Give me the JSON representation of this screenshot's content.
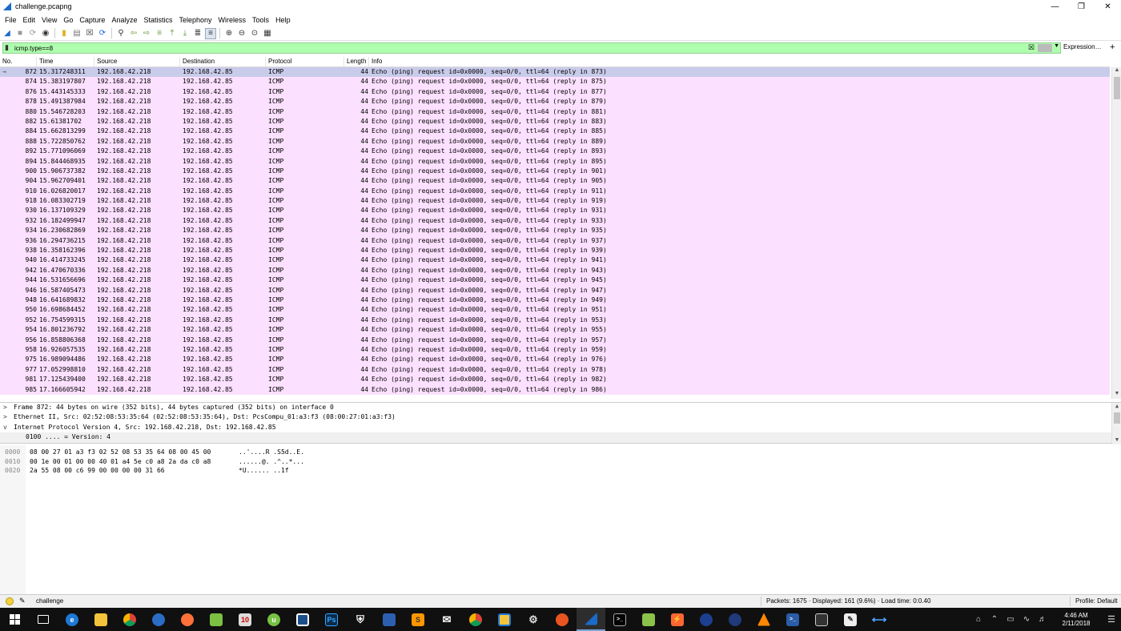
{
  "window": {
    "title": "challenge.pcapng"
  },
  "menu": [
    "File",
    "Edit",
    "View",
    "Go",
    "Capture",
    "Analyze",
    "Statistics",
    "Telephony",
    "Wireless",
    "Tools",
    "Help"
  ],
  "filter": {
    "value": "icmp.type==8",
    "expression_label": "Expression…",
    "add_label": "+"
  },
  "columns": [
    "No.",
    "Time",
    "Source",
    "Destination",
    "Protocol",
    "Length",
    "Info"
  ],
  "packets": [
    {
      "no": "872",
      "time": "15.317248311",
      "src": "192.168.42.218",
      "dst": "192.168.42.85",
      "proto": "ICMP",
      "len": "44",
      "info": "Echo (ping) request  id=0x0000, seq=0/0, ttl=64 (reply in 873)"
    },
    {
      "no": "874",
      "time": "15.383197807",
      "src": "192.168.42.218",
      "dst": "192.168.42.85",
      "proto": "ICMP",
      "len": "44",
      "info": "Echo (ping) request  id=0x0000, seq=0/0, ttl=64 (reply in 875)"
    },
    {
      "no": "876",
      "time": "15.443145333",
      "src": "192.168.42.218",
      "dst": "192.168.42.85",
      "proto": "ICMP",
      "len": "44",
      "info": "Echo (ping) request  id=0x0000, seq=0/0, ttl=64 (reply in 877)"
    },
    {
      "no": "878",
      "time": "15.491387984",
      "src": "192.168.42.218",
      "dst": "192.168.42.85",
      "proto": "ICMP",
      "len": "44",
      "info": "Echo (ping) request  id=0x0000, seq=0/0, ttl=64 (reply in 879)"
    },
    {
      "no": "880",
      "time": "15.546728203",
      "src": "192.168.42.218",
      "dst": "192.168.42.85",
      "proto": "ICMP",
      "len": "44",
      "info": "Echo (ping) request  id=0x0000, seq=0/0, ttl=64 (reply in 881)"
    },
    {
      "no": "882",
      "time": "15.61381702",
      "src": "192.168.42.218",
      "dst": "192.168.42.85",
      "proto": "ICMP",
      "len": "44",
      "info": "Echo (ping) request  id=0x0000, seq=0/0, ttl=64 (reply in 883)"
    },
    {
      "no": "884",
      "time": "15.662813299",
      "src": "192.168.42.218",
      "dst": "192.168.42.85",
      "proto": "ICMP",
      "len": "44",
      "info": "Echo (ping) request  id=0x0000, seq=0/0, ttl=64 (reply in 885)"
    },
    {
      "no": "888",
      "time": "15.722850762",
      "src": "192.168.42.218",
      "dst": "192.168.42.85",
      "proto": "ICMP",
      "len": "44",
      "info": "Echo (ping) request  id=0x0000, seq=0/0, ttl=64 (reply in 889)"
    },
    {
      "no": "892",
      "time": "15.771096069",
      "src": "192.168.42.218",
      "dst": "192.168.42.85",
      "proto": "ICMP",
      "len": "44",
      "info": "Echo (ping) request  id=0x0000, seq=0/0, ttl=64 (reply in 893)"
    },
    {
      "no": "894",
      "time": "15.844468935",
      "src": "192.168.42.218",
      "dst": "192.168.42.85",
      "proto": "ICMP",
      "len": "44",
      "info": "Echo (ping) request  id=0x0000, seq=0/0, ttl=64 (reply in 895)"
    },
    {
      "no": "900",
      "time": "15.906737382",
      "src": "192.168.42.218",
      "dst": "192.168.42.85",
      "proto": "ICMP",
      "len": "44",
      "info": "Echo (ping) request  id=0x0000, seq=0/0, ttl=64 (reply in 901)"
    },
    {
      "no": "904",
      "time": "15.962709401",
      "src": "192.168.42.218",
      "dst": "192.168.42.85",
      "proto": "ICMP",
      "len": "44",
      "info": "Echo (ping) request  id=0x0000, seq=0/0, ttl=64 (reply in 905)"
    },
    {
      "no": "910",
      "time": "16.026820017",
      "src": "192.168.42.218",
      "dst": "192.168.42.85",
      "proto": "ICMP",
      "len": "44",
      "info": "Echo (ping) request  id=0x0000, seq=0/0, ttl=64 (reply in 911)"
    },
    {
      "no": "918",
      "time": "16.083302719",
      "src": "192.168.42.218",
      "dst": "192.168.42.85",
      "proto": "ICMP",
      "len": "44",
      "info": "Echo (ping) request  id=0x0000, seq=0/0, ttl=64 (reply in 919)"
    },
    {
      "no": "930",
      "time": "16.137109329",
      "src": "192.168.42.218",
      "dst": "192.168.42.85",
      "proto": "ICMP",
      "len": "44",
      "info": "Echo (ping) request  id=0x0000, seq=0/0, ttl=64 (reply in 931)"
    },
    {
      "no": "932",
      "time": "16.182499947",
      "src": "192.168.42.218",
      "dst": "192.168.42.85",
      "proto": "ICMP",
      "len": "44",
      "info": "Echo (ping) request  id=0x0000, seq=0/0, ttl=64 (reply in 933)"
    },
    {
      "no": "934",
      "time": "16.230682869",
      "src": "192.168.42.218",
      "dst": "192.168.42.85",
      "proto": "ICMP",
      "len": "44",
      "info": "Echo (ping) request  id=0x0000, seq=0/0, ttl=64 (reply in 935)"
    },
    {
      "no": "936",
      "time": "16.294736215",
      "src": "192.168.42.218",
      "dst": "192.168.42.85",
      "proto": "ICMP",
      "len": "44",
      "info": "Echo (ping) request  id=0x0000, seq=0/0, ttl=64 (reply in 937)"
    },
    {
      "no": "938",
      "time": "16.358162396",
      "src": "192.168.42.218",
      "dst": "192.168.42.85",
      "proto": "ICMP",
      "len": "44",
      "info": "Echo (ping) request  id=0x0000, seq=0/0, ttl=64 (reply in 939)"
    },
    {
      "no": "940",
      "time": "16.414733245",
      "src": "192.168.42.218",
      "dst": "192.168.42.85",
      "proto": "ICMP",
      "len": "44",
      "info": "Echo (ping) request  id=0x0000, seq=0/0, ttl=64 (reply in 941)"
    },
    {
      "no": "942",
      "time": "16.470670336",
      "src": "192.168.42.218",
      "dst": "192.168.42.85",
      "proto": "ICMP",
      "len": "44",
      "info": "Echo (ping) request  id=0x0000, seq=0/0, ttl=64 (reply in 943)"
    },
    {
      "no": "944",
      "time": "16.531656696",
      "src": "192.168.42.218",
      "dst": "192.168.42.85",
      "proto": "ICMP",
      "len": "44",
      "info": "Echo (ping) request  id=0x0000, seq=0/0, ttl=64 (reply in 945)"
    },
    {
      "no": "946",
      "time": "16.587405473",
      "src": "192.168.42.218",
      "dst": "192.168.42.85",
      "proto": "ICMP",
      "len": "44",
      "info": "Echo (ping) request  id=0x0000, seq=0/0, ttl=64 (reply in 947)"
    },
    {
      "no": "948",
      "time": "16.641689832",
      "src": "192.168.42.218",
      "dst": "192.168.42.85",
      "proto": "ICMP",
      "len": "44",
      "info": "Echo (ping) request  id=0x0000, seq=0/0, ttl=64 (reply in 949)"
    },
    {
      "no": "950",
      "time": "16.698684452",
      "src": "192.168.42.218",
      "dst": "192.168.42.85",
      "proto": "ICMP",
      "len": "44",
      "info": "Echo (ping) request  id=0x0000, seq=0/0, ttl=64 (reply in 951)"
    },
    {
      "no": "952",
      "time": "16.754599315",
      "src": "192.168.42.218",
      "dst": "192.168.42.85",
      "proto": "ICMP",
      "len": "44",
      "info": "Echo (ping) request  id=0x0000, seq=0/0, ttl=64 (reply in 953)"
    },
    {
      "no": "954",
      "time": "16.801236792",
      "src": "192.168.42.218",
      "dst": "192.168.42.85",
      "proto": "ICMP",
      "len": "44",
      "info": "Echo (ping) request  id=0x0000, seq=0/0, ttl=64 (reply in 955)"
    },
    {
      "no": "956",
      "time": "16.858806368",
      "src": "192.168.42.218",
      "dst": "192.168.42.85",
      "proto": "ICMP",
      "len": "44",
      "info": "Echo (ping) request  id=0x0000, seq=0/0, ttl=64 (reply in 957)"
    },
    {
      "no": "958",
      "time": "16.926057535",
      "src": "192.168.42.218",
      "dst": "192.168.42.85",
      "proto": "ICMP",
      "len": "44",
      "info": "Echo (ping) request  id=0x0000, seq=0/0, ttl=64 (reply in 959)"
    },
    {
      "no": "975",
      "time": "16.989094486",
      "src": "192.168.42.218",
      "dst": "192.168.42.85",
      "proto": "ICMP",
      "len": "44",
      "info": "Echo (ping) request  id=0x0000, seq=0/0, ttl=64 (reply in 976)"
    },
    {
      "no": "977",
      "time": "17.052998810",
      "src": "192.168.42.218",
      "dst": "192.168.42.85",
      "proto": "ICMP",
      "len": "44",
      "info": "Echo (ping) request  id=0x0000, seq=0/0, ttl=64 (reply in 978)"
    },
    {
      "no": "981",
      "time": "17.125439400",
      "src": "192.168.42.218",
      "dst": "192.168.42.85",
      "proto": "ICMP",
      "len": "44",
      "info": "Echo (ping) request  id=0x0000, seq=0/0, ttl=64 (reply in 982)"
    },
    {
      "no": "985",
      "time": "17.166605942",
      "src": "192.168.42.218",
      "dst": "192.168.42.85",
      "proto": "ICMP",
      "len": "44",
      "info": "Echo (ping) request  id=0x0000, seq=0/0, ttl=64 (reply in 986)"
    }
  ],
  "details": [
    {
      "twisty": ">",
      "text": "Frame 872: 44 bytes on wire (352 bits), 44 bytes captured (352 bits) on interface 0"
    },
    {
      "twisty": ">",
      "text": "Ethernet II, Src: 02:52:08:53:35:64 (02:52:08:53:35:64), Dst: PcsCompu_01:a3:f3 (08:00:27:01:a3:f3)"
    },
    {
      "twisty": "v",
      "text": "Internet Protocol Version 4, Src: 192.168.42.218, Dst: 192.168.42.85"
    },
    {
      "twisty": "",
      "text": "0100 .... = Version: 4"
    }
  ],
  "bytes": [
    {
      "offset": "0000",
      "hex": "08 00 27 01 a3 f3 02 52  08 53 35 64 08 00 45 00",
      "ascii": "..'....R .S5d..E."
    },
    {
      "offset": "0010",
      "hex": "00 1e 00 01 00 00 40 01  a4 5e c0 a8 2a da c0 a8",
      "ascii": "......@. .^..*..."
    },
    {
      "offset": "0020",
      "hex": "2a 55 08 00 c6 99 00 00  00 00 31 66",
      "ascii": "*U...... ..1f"
    }
  ],
  "status": {
    "file": "challenge",
    "packets": "Packets: 1675 · Displayed: 161 (9.6%) · Load time: 0:0.40",
    "profile": "Profile: Default"
  },
  "clock": {
    "time": "4:46 AM",
    "date": "2/11/2018"
  },
  "colors": {
    "row_bg": "#fce0ff",
    "selected_bg": "#c9cbea",
    "filter_ok": "#afffaf",
    "taskbar": "#101010"
  },
  "taskbar_icons": [
    "windows-icon",
    "task-view-icon",
    "edge-icon",
    "file-explorer-icon",
    "chrome-icon",
    "thunderbird-icon",
    "firefox-icon",
    "notepadpp-icon",
    "calendar-icon",
    "utorrent-icon",
    "app-icon",
    "photoshop-icon",
    "shield-icon",
    "network-icon",
    "sublime-icon",
    "mail-icon",
    "chrome-icon",
    "folder-icon",
    "settings-icon",
    "ubuntu-icon",
    "wireshark-icon",
    "terminal-icon",
    "notepad-icon",
    "burp-icon",
    "vpn-icon",
    "globe-icon",
    "vlc-icon",
    "powershell-icon",
    "tool-icon",
    "editor-icon",
    "teamviewer-icon"
  ]
}
